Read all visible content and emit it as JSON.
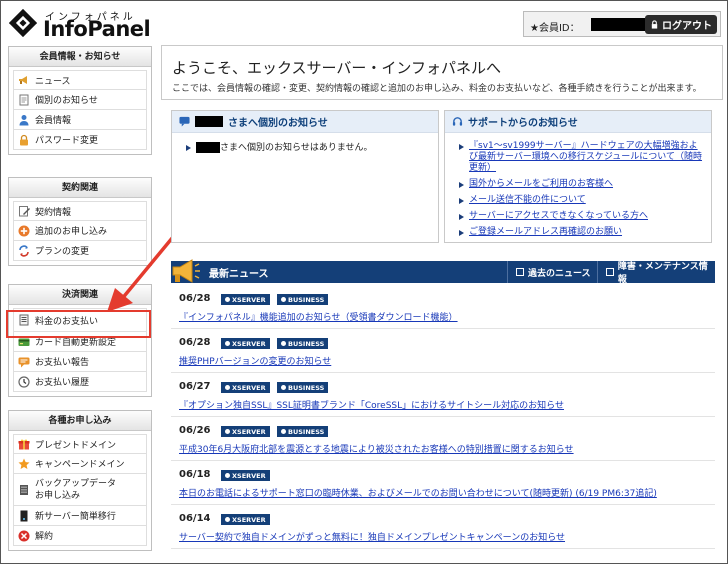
{
  "header": {
    "logo_kana": "インフォパネル",
    "logo_text": "InfoPanel",
    "member_label": "★会員ID：",
    "logout_label": "ログアウト"
  },
  "sidebar": {
    "sections": [
      {
        "title": "会員情報・お知らせ",
        "items": [
          "ニュース",
          "個別のお知らせ",
          "会員情報",
          "パスワード変更"
        ]
      },
      {
        "title": "契約関連",
        "items": [
          "契約情報",
          "追加のお申し込み",
          "プランの変更"
        ]
      },
      {
        "title": "決済関連",
        "items": [
          "料金のお支払い",
          "カード自動更新設定",
          "お支払い報告",
          "お支払い履歴"
        ]
      },
      {
        "title": "各種お申し込み",
        "items": [
          "プレゼントドメイン",
          "キャンペーンドメイン",
          "バックアップデータ",
          "お申し込み",
          "新サーバー簡単移行",
          "解約"
        ]
      }
    ]
  },
  "welcome": {
    "title": "ようこそ、エックスサーバー・インフォパネルへ",
    "description": "ここでは、会員情報の確認・変更、契約情報の確認と追加のお申し込み、料金のお支払いなど、各種手続きを行うことが出来ます。"
  },
  "personal_notice": {
    "title_suffix": "さまへ個別のお知らせ",
    "message_suffix": "さまへ個別のお知らせはありません。"
  },
  "support_notice": {
    "title": "サポートからのお知らせ",
    "items": [
      "『sv1～sv1999サーバー』ハードウェアの大幅増強および最新サーバー環境への移行スケジュールについて（随時更新）",
      "国外からメールをご利用のお客様へ",
      "メール送信不能の件について",
      "サーバーにアクセスできなくなっている方へ",
      "ご登録メールアドレス再確認のお願い"
    ]
  },
  "news": {
    "title": "最新ニュース",
    "past_news": "過去のニュース",
    "maintenance": "障害・メンテナンス情報",
    "items": [
      {
        "date": "06/28",
        "tags": [
          "XSERVER",
          "BUSINESS"
        ],
        "text": "『インフォパネル』機能追加のお知らせ（受領書ダウンロード機能）"
      },
      {
        "date": "06/28",
        "tags": [
          "XSERVER",
          "BUSINESS"
        ],
        "text": "推奨PHPバージョンの変更のお知らせ"
      },
      {
        "date": "06/27",
        "tags": [
          "XSERVER",
          "BUSINESS"
        ],
        "text": "『オプション独自SSL』SSL証明書ブランド「CoreSSL」におけるサイトシール対応のお知らせ"
      },
      {
        "date": "06/26",
        "tags": [
          "XSERVER",
          "BUSINESS"
        ],
        "text": "平成30年6月大阪府北部を震源とする地震により被災されたお客様への特別措置に関するお知らせ"
      },
      {
        "date": "06/18",
        "tags": [
          "XSERVER"
        ],
        "text": "本日のお電話によるサポート窓口の臨時休業、およびメールでのお問い合わせについて(随時更新) (6/19 PM6:37追記)"
      },
      {
        "date": "06/14",
        "tags": [
          "XSERVER"
        ],
        "text": "サーバー契約で独自ドメインがずっと無料に！独自ドメインプレゼントキャンペーンのお知らせ"
      }
    ]
  },
  "colors": {
    "navy": "#143f78",
    "link": "#1838b8",
    "highlight": "#e43b2e"
  }
}
